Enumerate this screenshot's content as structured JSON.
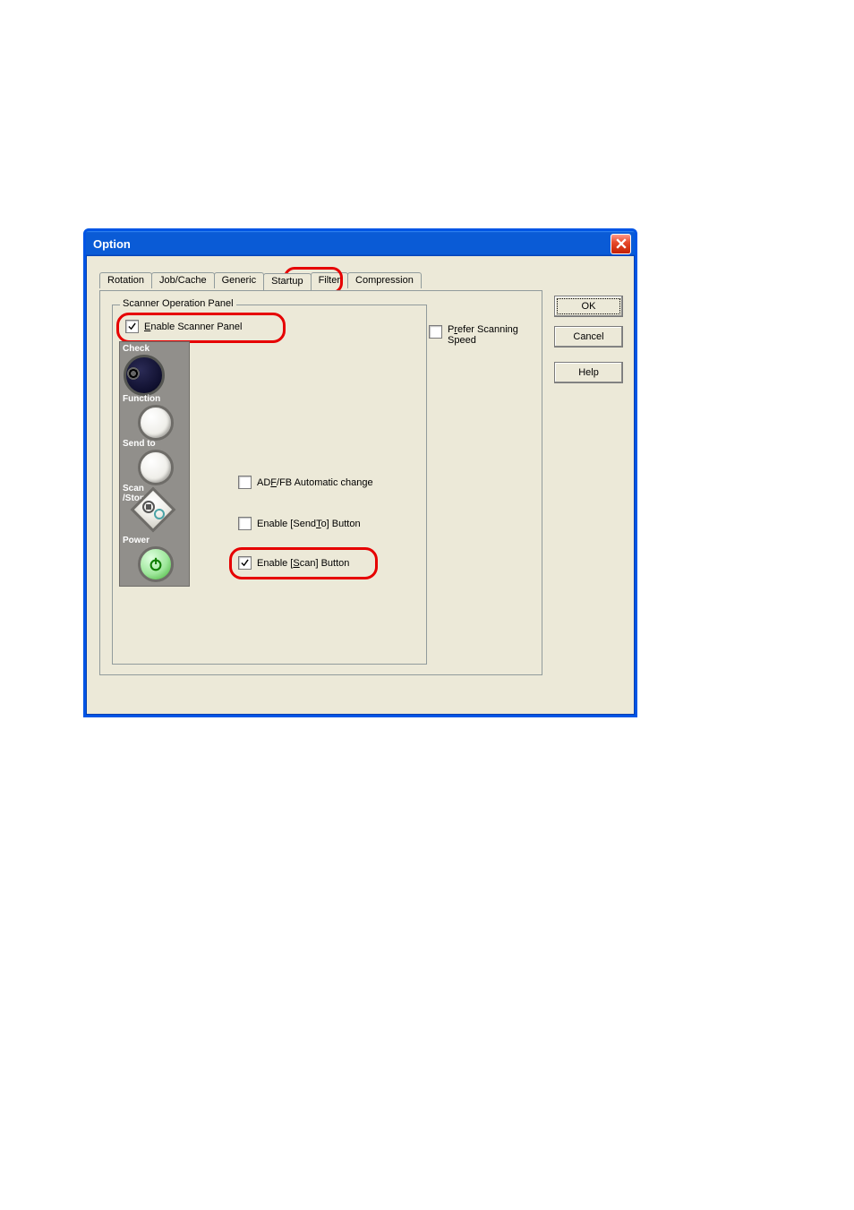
{
  "titlebar": {
    "title": "Option"
  },
  "tabs": {
    "rotation": "Rotation",
    "job": "Job/Cache",
    "generic": "Generic",
    "startup": "Startup",
    "filter": "Filter",
    "compression": "Compression"
  },
  "group": {
    "legend": "Scanner Operation Panel",
    "enable_panel_pre": "E",
    "enable_panel_rest": "nable Scanner Panel",
    "adf_pre": "AD",
    "adf_u": "F",
    "adf_rest": "/FB Automatic change",
    "sendto_pre": "Enable [Send",
    "sendto_u": "T",
    "sendto_rest": "o] Button",
    "scan_pre": "Enable [",
    "scan_u": "S",
    "scan_rest": "can] Button"
  },
  "prefer": {
    "line1_pre": "P",
    "line1_u": "r",
    "line1_rest": "efer Scanning",
    "line2": "Speed"
  },
  "buttons": {
    "ok": "OK",
    "cancel": "Cancel",
    "help": "Help"
  },
  "panel": {
    "check": "Check",
    "function": "Function",
    "sendto": "Send to",
    "scan": "Scan",
    "stop": "/Stop",
    "power": "Power"
  }
}
